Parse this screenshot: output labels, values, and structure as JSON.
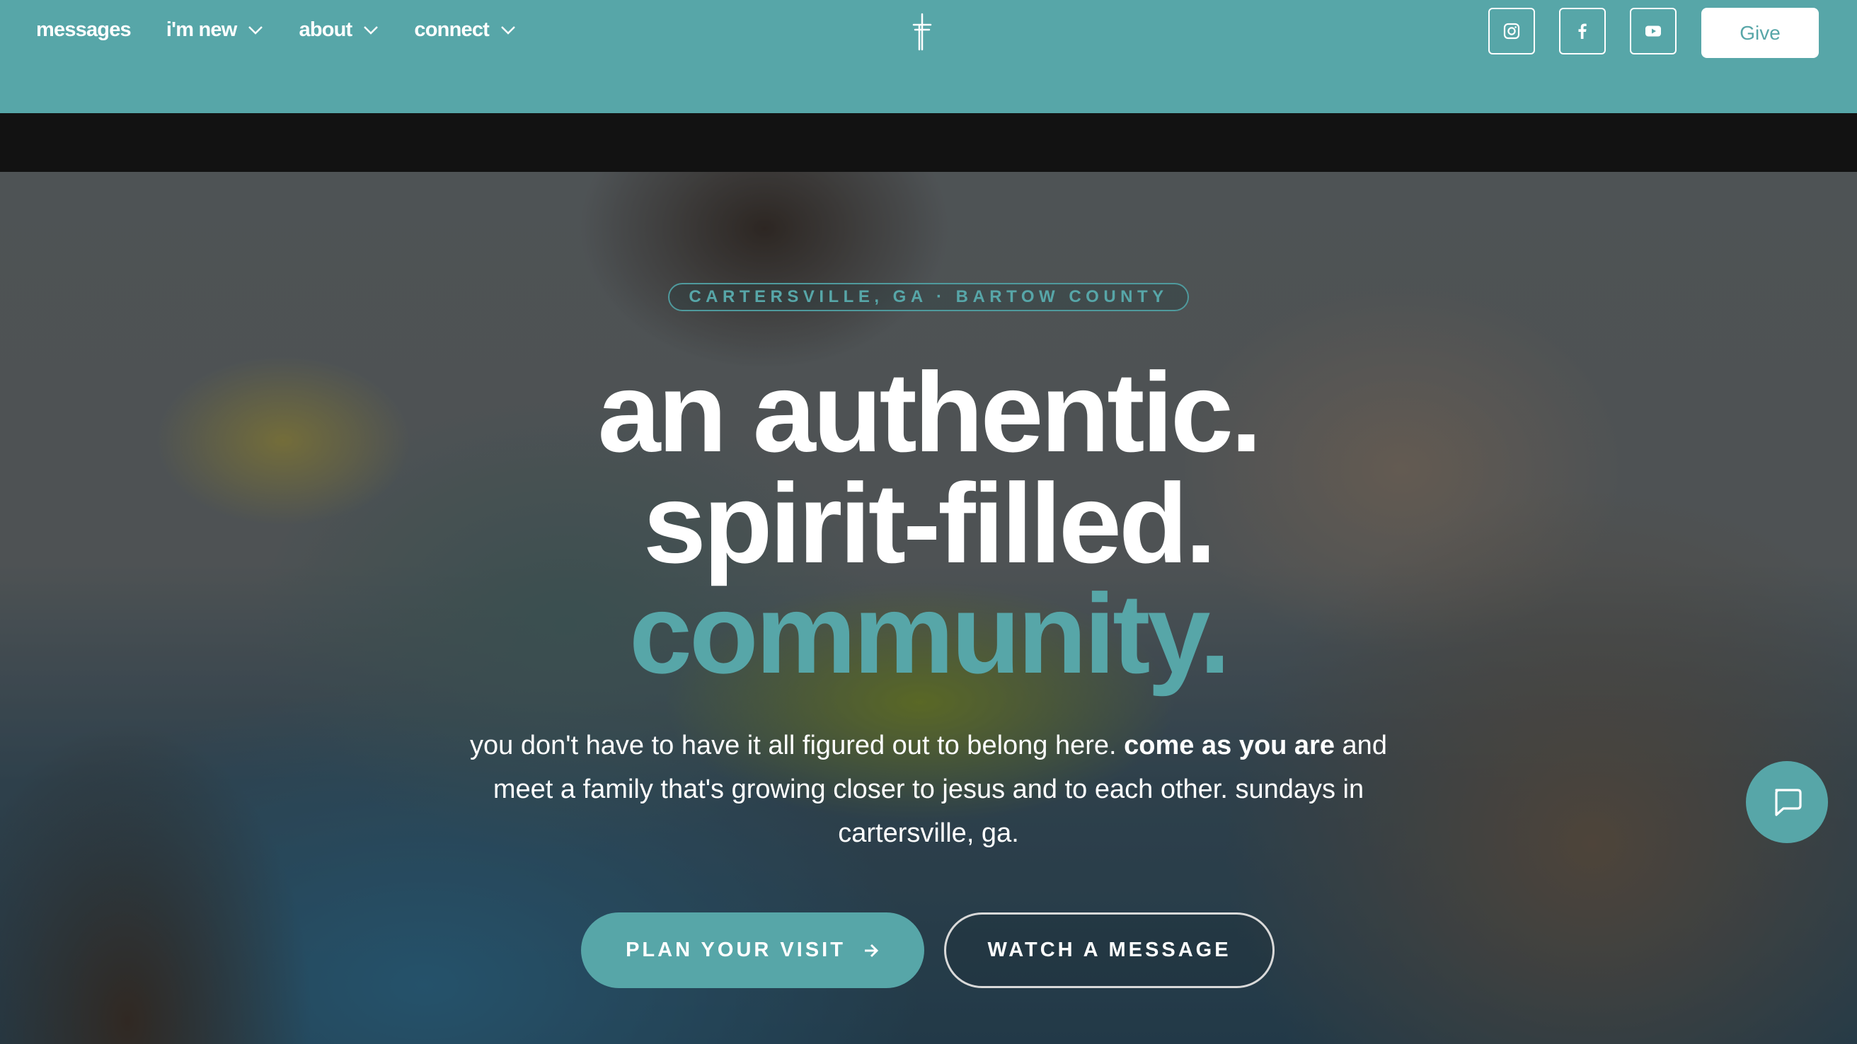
{
  "header": {
    "nav": [
      {
        "label": "messages",
        "icon": null
      },
      {
        "label": "i'm new",
        "icon": "chevron-down-icon"
      },
      {
        "label": "about",
        "icon": "chevron-down-icon"
      },
      {
        "label": "connect",
        "icon": "chevron-down-icon"
      }
    ],
    "logo_icon": "cross-logo-icon",
    "socials": [
      "instagram-icon",
      "facebook-icon",
      "youtube-icon"
    ],
    "give_label": "Give"
  },
  "hero": {
    "location": "CARTERSVILLE, GA · BARTOW COUNTY",
    "headline_1": "an authentic.",
    "headline_2": "spirit-filled.",
    "headline_3": "community.",
    "sub_lead": "you don't have to have it all figured out to belong here.",
    "sub_bold": "come as you are",
    "sub_tail": "and meet a family that's growing closer to jesus and to each other. sundays in cartersville, ga.",
    "primary_cta": "PLAN YOUR VISIT",
    "secondary_cta": "WATCH A MESSAGE"
  },
  "chat": {
    "icon": "chat-bubble-icon"
  },
  "colors": {
    "brand_teal": "#57a6a8",
    "band": "#121212",
    "white": "#ffffff"
  }
}
